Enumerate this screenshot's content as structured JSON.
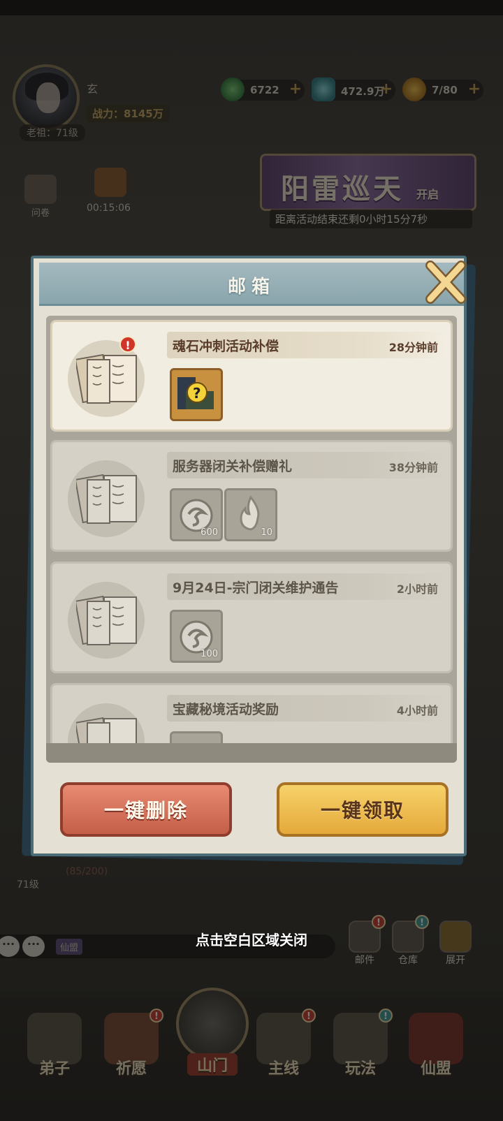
{
  "hud": {
    "player_name": "玄",
    "power": "战力：8145万",
    "level": "老祖：71级",
    "resources": [
      {
        "icon": "jade-coin-icon",
        "value": "6722",
        "plus": "+"
      },
      {
        "icon": "spirit-stone-icon",
        "value": "472.9万",
        "plus": "+"
      },
      {
        "icon": "energy-gourd-icon",
        "value": "7/80",
        "plus": "+"
      }
    ],
    "survey_label": "问卷",
    "timer": "00:15:06"
  },
  "event_banner": {
    "title": "阳雷巡天",
    "badge": "开启",
    "countdown": "距离活动结束还剩0小时15分7秒"
  },
  "mailbox": {
    "title": "邮箱",
    "mails": [
      {
        "subject": "魂石冲刺活动补偿",
        "time": "28分钟前",
        "unread": true,
        "items": [
          {
            "icon": "mystery-chest-icon",
            "qty": ""
          }
        ]
      },
      {
        "subject": "服务器闭关补偿赠礼",
        "time": "38分钟前",
        "unread": false,
        "items": [
          {
            "icon": "dragon-token-icon",
            "qty": "600"
          },
          {
            "icon": "flame-token-icon",
            "qty": "10"
          }
        ]
      },
      {
        "subject": "9月24日-宗门闭关维护通告",
        "time": "2小时前",
        "unread": false,
        "items": [
          {
            "icon": "dragon-token-icon",
            "qty": "100"
          }
        ]
      },
      {
        "subject": "宝藏秘境活动奖励",
        "time": "4小时前",
        "unread": false,
        "items": [
          {
            "icon": "reward-item-icon",
            "qty": ""
          }
        ]
      }
    ],
    "delete_all": "一键删除",
    "claim_all": "一键领取"
  },
  "bottom": {
    "close_hint": "点击空白区域关闭",
    "level": "71级",
    "exp": "(85/200)",
    "guild_tag": "仙盟",
    "quick_buttons": [
      {
        "label": "邮件",
        "badge": "!"
      },
      {
        "label": "仓库",
        "badge": "!"
      },
      {
        "label": "展开",
        "badge": ""
      }
    ],
    "nav": [
      {
        "label": "弟子"
      },
      {
        "label": "祈愿"
      },
      {
        "label": "山门"
      },
      {
        "label": "主线"
      },
      {
        "label": "玩法"
      },
      {
        "label": "仙盟"
      }
    ]
  },
  "colors": {
    "dialog_header": "#8aa5ac",
    "delete_button": "#c45e48",
    "claim_button": "#e5a93a",
    "badge_red": "#c83a2e"
  }
}
